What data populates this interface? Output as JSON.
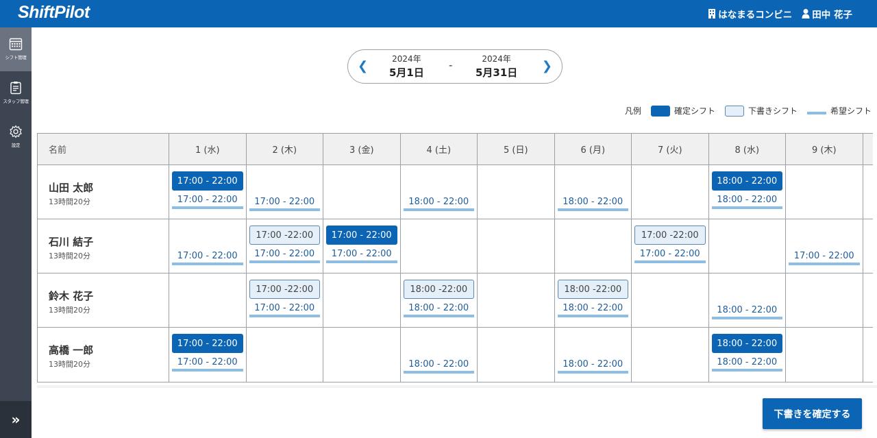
{
  "app": {
    "logo": "ShiftPilot",
    "store": "はなまるコンビニ",
    "user": "田中 花子"
  },
  "sidebar": {
    "items": [
      {
        "label": "シフト管理",
        "icon": "calendar-icon"
      },
      {
        "label": "スタッフ管理",
        "icon": "clipboard-icon"
      },
      {
        "label": "設定",
        "icon": "gear-icon"
      }
    ],
    "expand_icon": "double-chevron-right-icon"
  },
  "range": {
    "start_year": "2024年",
    "start_date": "5月1日",
    "separator": "-",
    "end_year": "2024年",
    "end_date": "5月31日"
  },
  "legend": {
    "title": "凡例",
    "confirmed": "確定シフト",
    "draft": "下書きシフト",
    "wish": "希望シフト"
  },
  "table": {
    "name_header": "名前",
    "days": [
      "1 (水)",
      "2 (木)",
      "3 (金)",
      "4 (土)",
      "5 (日)",
      "6 (月)",
      "7 (火)",
      "8 (水)",
      "9 (木)",
      ""
    ],
    "rows": [
      {
        "name": "山田 太郎",
        "hours": "13時間20分",
        "cells": [
          {
            "confirmed": "17:00 - 22:00",
            "wish": "17:00 - 22:00"
          },
          {
            "wish": "17:00 - 22:00"
          },
          {},
          {
            "wish": "18:00 - 22:00"
          },
          {},
          {
            "wish": "18:00 - 22:00"
          },
          {},
          {
            "confirmed": "18:00 - 22:00",
            "wish": "18:00 - 22:00"
          },
          {},
          {}
        ]
      },
      {
        "name": "石川 結子",
        "hours": "13時間20分",
        "cells": [
          {
            "wish": "17:00 - 22:00"
          },
          {
            "draft": "17:00 -22:00",
            "wish": "17:00 - 22:00"
          },
          {
            "confirmed": "17:00 - 22:00",
            "wish": "17:00 - 22:00"
          },
          {},
          {},
          {},
          {
            "draft": "17:00 -22:00",
            "wish": "17:00 - 22:00"
          },
          {},
          {
            "wish": "17:00 - 22:00"
          },
          {}
        ]
      },
      {
        "name": "鈴木 花子",
        "hours": "13時間20分",
        "cells": [
          {},
          {
            "draft": "17:00 -22:00",
            "wish": "17:00 - 22:00"
          },
          {},
          {
            "draft": "18:00 -22:00",
            "wish": "18:00 - 22:00"
          },
          {},
          {
            "draft": "18:00 -22:00",
            "wish": "18:00 - 22:00"
          },
          {},
          {
            "wish": "18:00 - 22:00"
          },
          {},
          {}
        ]
      },
      {
        "name": "高橋 一郎",
        "hours": "13時間20分",
        "cells": [
          {
            "confirmed": "17:00 - 22:00",
            "wish": "17:00 - 22:00"
          },
          {},
          {},
          {
            "wish": "18:00 - 22:00"
          },
          {},
          {
            "wish": "18:00 - 22:00"
          },
          {},
          {
            "confirmed": "18:00 - 22:00",
            "wish": "18:00 - 22:00"
          },
          {},
          {}
        ]
      }
    ]
  },
  "confirm_button": "下書きを確定する",
  "colors": {
    "primary": "#0B64B4",
    "sidebar": "#3D4552",
    "draft_bg": "#E4EFFA",
    "wish_line": "#8EBDE4"
  }
}
